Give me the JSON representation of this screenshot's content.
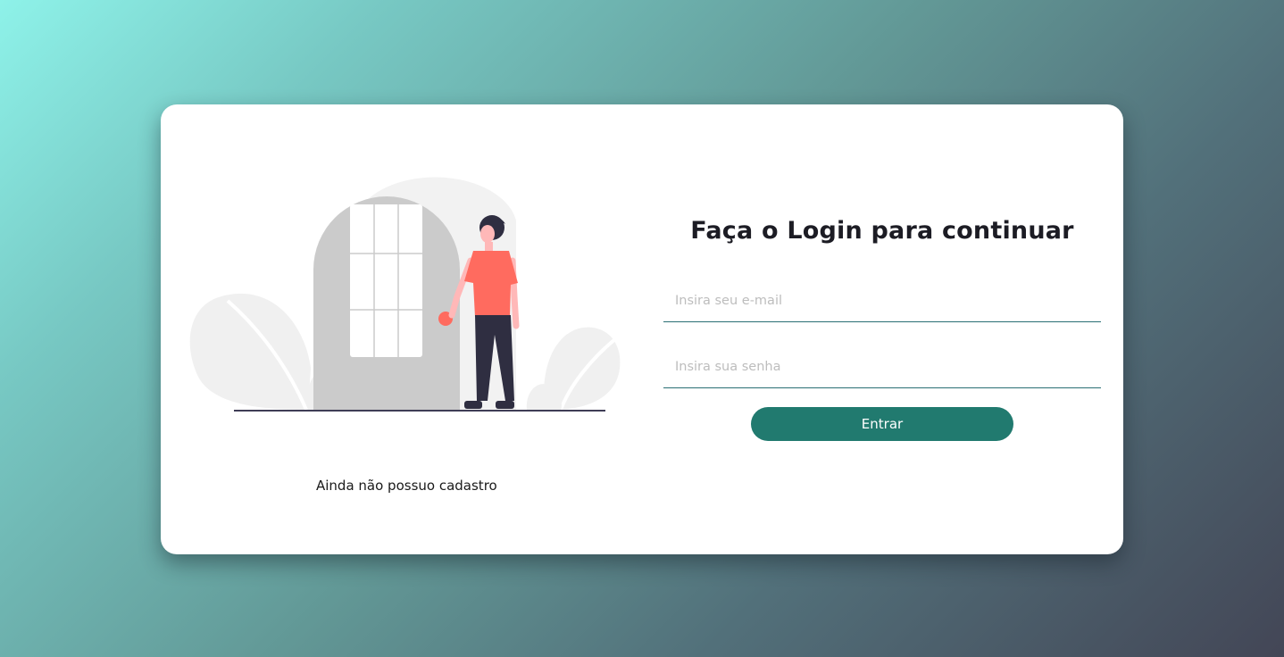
{
  "login": {
    "title": "Faça o Login para continuar",
    "email_placeholder": "Insira seu e-mail",
    "password_placeholder": "Insira sua senha",
    "submit_label": "Entrar",
    "signup_link": "Ainda não possuo cadastro"
  },
  "illustration": {
    "name": "person-at-door-illustration"
  },
  "colors": {
    "accent": "#217a6f",
    "input_underline": "#2a6f74",
    "shirt": "#ff6b5f",
    "door": "#cbcbcb",
    "foliage": "#f2f2f2"
  }
}
